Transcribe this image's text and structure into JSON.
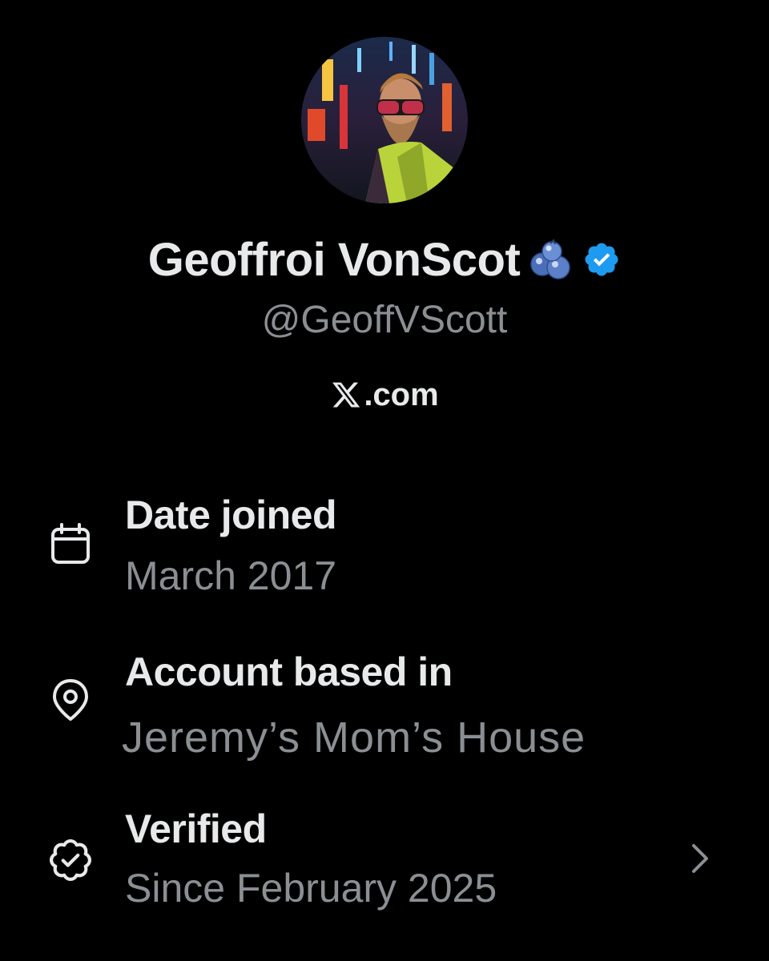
{
  "profile": {
    "display_name": "Geoffroi VonScot",
    "handle": "@GeoffVScott",
    "site": ".com",
    "avatar_icon": "profile-photo",
    "emoji_icon": "blueberries-icon",
    "verified_color": "#1d9bf0"
  },
  "details": {
    "joined": {
      "label": "Date joined",
      "value": "March 2017",
      "icon": "calendar-icon"
    },
    "location": {
      "label": "Account based in",
      "value": "Jeremy’s Mom’s House",
      "icon": "location-pin-icon"
    },
    "verified": {
      "label": "Verified",
      "value": "Since February 2025",
      "icon": "verified-badge-icon"
    }
  },
  "colors": {
    "background": "#000000",
    "primary_text": "#e7e9ea",
    "secondary_text": "#8b8f94",
    "verified_blue": "#1d9bf0"
  }
}
